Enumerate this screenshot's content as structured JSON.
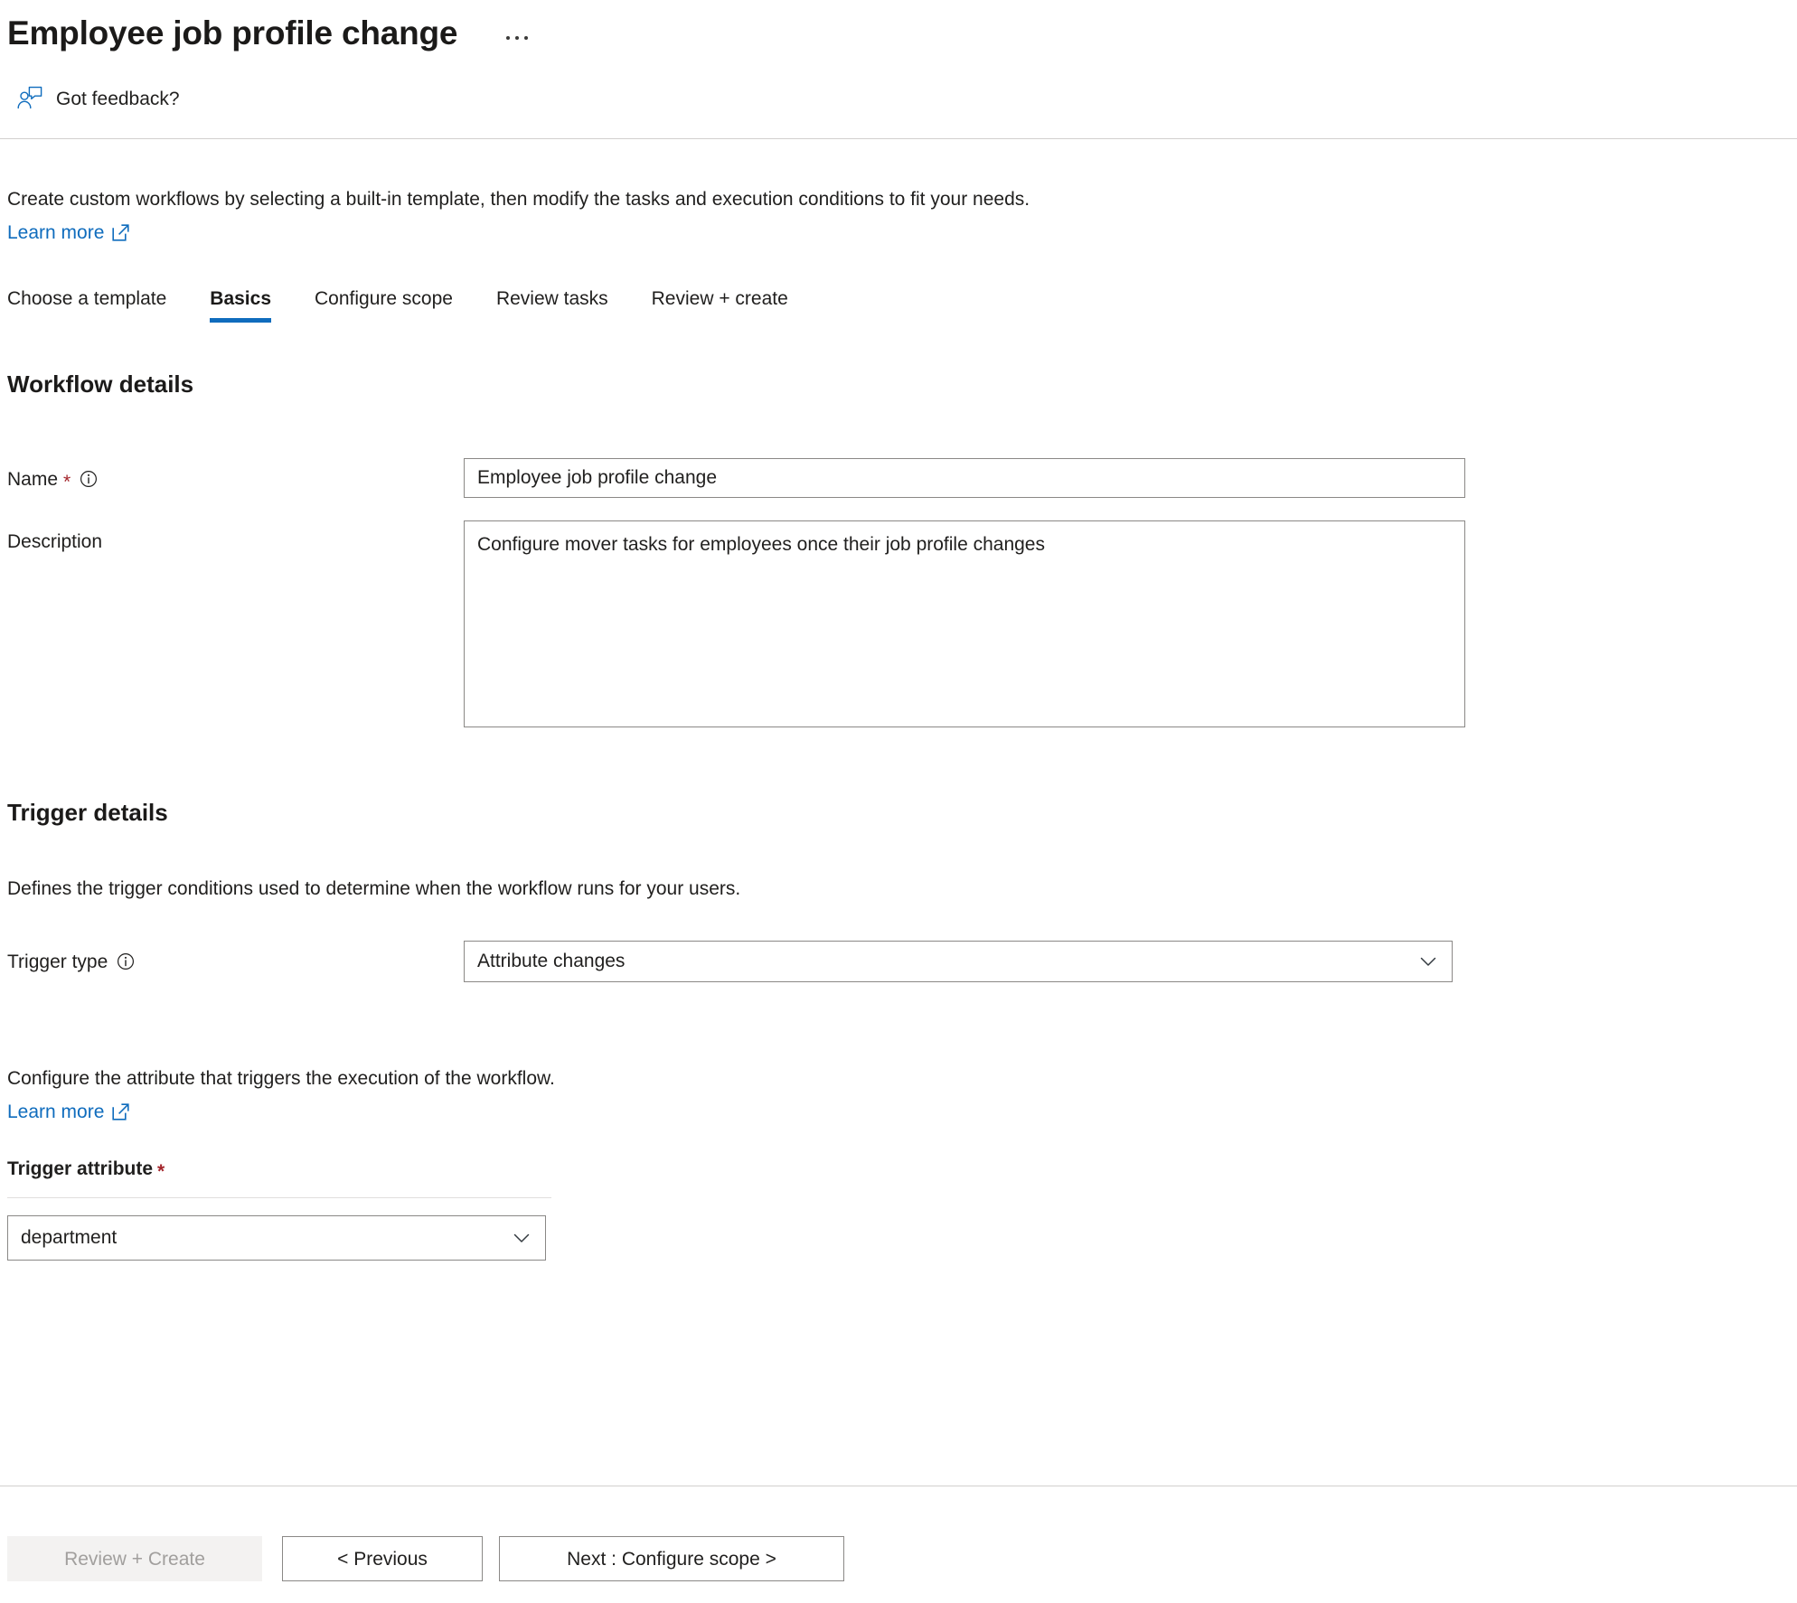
{
  "header": {
    "title": "Employee job profile change",
    "more_menu": "...",
    "feedback_label": "Got feedback?",
    "feedback_icon": "person-feedback-icon"
  },
  "intro": {
    "text": "Create custom workflows by selecting a built-in template, then modify the tasks and execution conditions to fit your needs.",
    "learn_more": "Learn more",
    "learn_more_icon": "external-link-icon"
  },
  "tabs": [
    {
      "label": "Choose a template",
      "active": false
    },
    {
      "label": "Basics",
      "active": true
    },
    {
      "label": "Configure scope",
      "active": false
    },
    {
      "label": "Review tasks",
      "active": false
    },
    {
      "label": "Review + create",
      "active": false
    }
  ],
  "workflow_details": {
    "section_title": "Workflow details",
    "name": {
      "label": "Name",
      "required_marker": "*",
      "info_icon": "info-icon",
      "value": "Employee job profile change",
      "placeholder": ""
    },
    "description": {
      "label": "Description",
      "value": "Configure mover tasks for employees once their job profile changes",
      "placeholder": ""
    }
  },
  "trigger_details": {
    "section_title": "Trigger details",
    "description": "Defines the trigger conditions used to determine when the workflow runs for your users.",
    "trigger_type": {
      "label": "Trigger type",
      "info_icon": "info-icon",
      "selected": "Attribute changes",
      "chevron_icon": "chevron-down-icon"
    },
    "attribute_section": {
      "description": "Configure the attribute that triggers the execution of the workflow.",
      "learn_more": "Learn more",
      "learn_more_icon": "external-link-icon",
      "label": "Trigger attribute",
      "required_marker": "*",
      "selected": "department",
      "chevron_icon": "chevron-down-icon"
    }
  },
  "footer": {
    "review_create": "Review + Create",
    "previous": "< Previous",
    "next": "Next : Configure scope >"
  },
  "colors": {
    "accent": "#0f6cbd",
    "required": "#a4262c",
    "border": "#8a8886",
    "divider": "#d2d0ce",
    "disabled_bg": "#f3f2f1",
    "disabled_text": "#a19f9d"
  }
}
